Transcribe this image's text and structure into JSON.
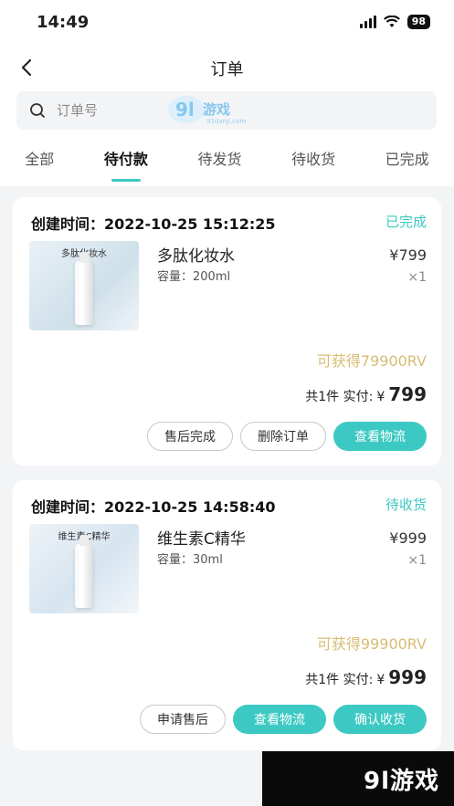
{
  "status_bar": {
    "time": "14:49",
    "battery": "98"
  },
  "nav": {
    "title": "订单"
  },
  "search": {
    "placeholder": "订单号"
  },
  "tabs": [
    {
      "label": "全部"
    },
    {
      "label": "待付款",
      "active": true
    },
    {
      "label": "待发货"
    },
    {
      "label": "待收货"
    },
    {
      "label": "已完成"
    }
  ],
  "orders": [
    {
      "created": "创建时间：2022-10-25 15:12:25",
      "state": "已完成",
      "thumb_caption": "多肽化妆水",
      "product_name": "多肽化妆水",
      "spec": "容量：200ml",
      "price": "¥799",
      "qty": "×1",
      "rv": "可获得79900RV",
      "summary_prefix": "共1件 实付:",
      "summary_currency": "¥",
      "summary_amount": "799",
      "buttons": [
        "售后完成",
        "删除订单",
        "查看物流"
      ]
    },
    {
      "created": "创建时间：2022-10-25 14:58:40",
      "state": "待收货",
      "thumb_caption": "维生素C精华",
      "product_name": "维生素C精华",
      "spec": "容量：30ml",
      "price": "¥999",
      "qty": "×1",
      "rv": "可获得99900RV",
      "summary_prefix": "共1件 实付:",
      "summary_currency": "¥",
      "summary_amount": "999",
      "buttons": [
        "申请售后",
        "查看物流",
        "确认收货"
      ]
    }
  ],
  "watermark": {
    "text": "9l游戏",
    "subtext": "91danji.com"
  },
  "colors": {
    "accent": "#3cc9c3",
    "rv_gold": "#d6bd72"
  }
}
